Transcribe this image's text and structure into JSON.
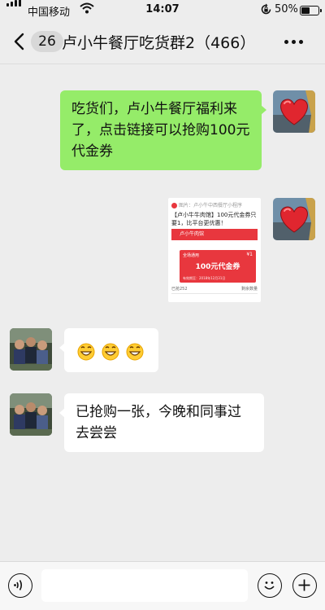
{
  "status_bar": {
    "carrier": "中国移动",
    "time": "14:07",
    "battery_percent": "50%",
    "battery_level": 0.5,
    "icons": [
      "signal-icon",
      "wifi-icon",
      "orientation-lock-icon",
      "battery-icon"
    ]
  },
  "nav": {
    "back_badge": "26",
    "title": "卢小牛餐厅吃货群2（466）",
    "icons": [
      "back-chevron-icon",
      "more-icon"
    ]
  },
  "messages": [
    {
      "side": "out",
      "type": "text",
      "text": "吃货们，卢小牛餐厅福利来了，点击链接可以抢购100元代金券",
      "avatar": "heart-avatar"
    },
    {
      "side": "out",
      "type": "image",
      "avatar": "heart-avatar",
      "card": {
        "source": "图片：卢小牛中西餐厅小程序",
        "headline": "【卢小牛牛肉馆】100元代金券只要1，比平台更优惠！",
        "shop": "卢小牛肉馆",
        "coupon_tag": "全场通用",
        "coupon_yen": "¥1",
        "coupon_value": "100元代金券",
        "coupon_small": "有效期至：2018年12月31日",
        "footer_left": "已抢252",
        "footer_right": "剩余数量"
      }
    },
    {
      "side": "in",
      "type": "emoji",
      "emojis": [
        "grin-emoji",
        "grin-emoji",
        "grin-emoji"
      ],
      "avatar": "group-photo-avatar"
    },
    {
      "side": "in",
      "type": "text",
      "text": "已抢购一张，今晚和同事过去尝尝",
      "avatar": "group-photo-avatar"
    }
  ],
  "bottom_bar": {
    "icons": [
      "voice-icon",
      "emoji-icon",
      "plus-icon"
    ],
    "input_placeholder": ""
  },
  "colors": {
    "background": "#ededed",
    "outgoing_bubble": "#95ec69",
    "incoming_bubble": "#ffffff",
    "coupon_red": "#e8373e"
  }
}
